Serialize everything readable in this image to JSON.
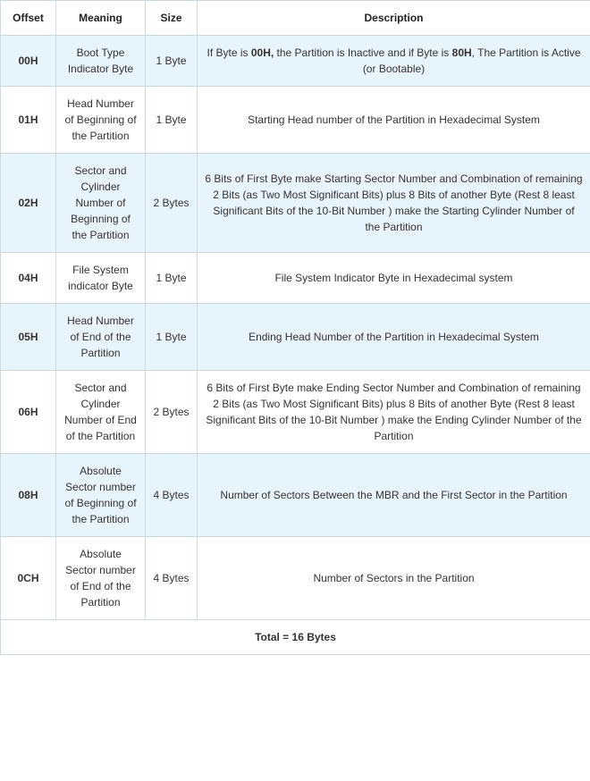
{
  "headers": {
    "offset": "Offset",
    "meaning": "Meaning",
    "size": "Size",
    "description": "Description"
  },
  "rows": [
    {
      "offset": "00H",
      "meaning": "Boot Type Indicator Byte",
      "size": "1 Byte",
      "description_segments": [
        {
          "text": "If Byte is ",
          "bold": false
        },
        {
          "text": "00H,",
          "bold": true
        },
        {
          "text": " the Partition is Inactive and if Byte is ",
          "bold": false
        },
        {
          "text": "80H",
          "bold": true
        },
        {
          "text": ", The Partition is Active (or Bootable)",
          "bold": false
        }
      ]
    },
    {
      "offset": "01H",
      "meaning": "Head Number of Beginning of the Partition",
      "size": "1 Byte",
      "description_segments": [
        {
          "text": "Starting Head number of the Partition in Hexadecimal System",
          "bold": false
        }
      ]
    },
    {
      "offset": "02H",
      "meaning": "Sector and Cylinder Number of Beginning of the Partition",
      "size": "2 Bytes",
      "description_segments": [
        {
          "text": "6 Bits of First Byte make Starting Sector Number and Combination of remaining 2 Bits (as Two Most Significant Bits) plus 8 Bits of another Byte (Rest 8 least Significant Bits of the 10-Bit Number ) make the Starting Cylinder Number of the Partition",
          "bold": false
        }
      ]
    },
    {
      "offset": "04H",
      "meaning": "File System indicator Byte",
      "size": "1 Byte",
      "description_segments": [
        {
          "text": "File System Indicator Byte in Hexadecimal system",
          "bold": false
        }
      ]
    },
    {
      "offset": "05H",
      "meaning": "Head Number of End of the Partition",
      "size": "1 Byte",
      "description_segments": [
        {
          "text": "Ending Head Number of the Partition in Hexadecimal System",
          "bold": false
        }
      ]
    },
    {
      "offset": "06H",
      "meaning": "Sector and Cylinder Number of End of the Partition",
      "size": "2 Bytes",
      "description_segments": [
        {
          "text": "6 Bits of First Byte make Ending Sector Number and Combination of remaining 2 Bits (as Two Most Significant Bits) plus 8 Bits of another Byte (Rest 8 least Significant Bits of the 10-Bit Number ) make the Ending Cylinder Number of the Partition",
          "bold": false
        }
      ]
    },
    {
      "offset": "08H",
      "meaning": "Absolute Sector number of Beginning of the Partition",
      "size": "4 Bytes",
      "description_segments": [
        {
          "text": "Number of Sectors Between the MBR and the First Sector in the Partition",
          "bold": false
        }
      ]
    },
    {
      "offset": "0CH",
      "meaning": "Absolute Sector number of End of the Partition",
      "size": "4 Bytes",
      "description_segments": [
        {
          "text": "Number of Sectors in the Partition",
          "bold": false
        }
      ]
    }
  ],
  "footer": "Total = 16 Bytes"
}
